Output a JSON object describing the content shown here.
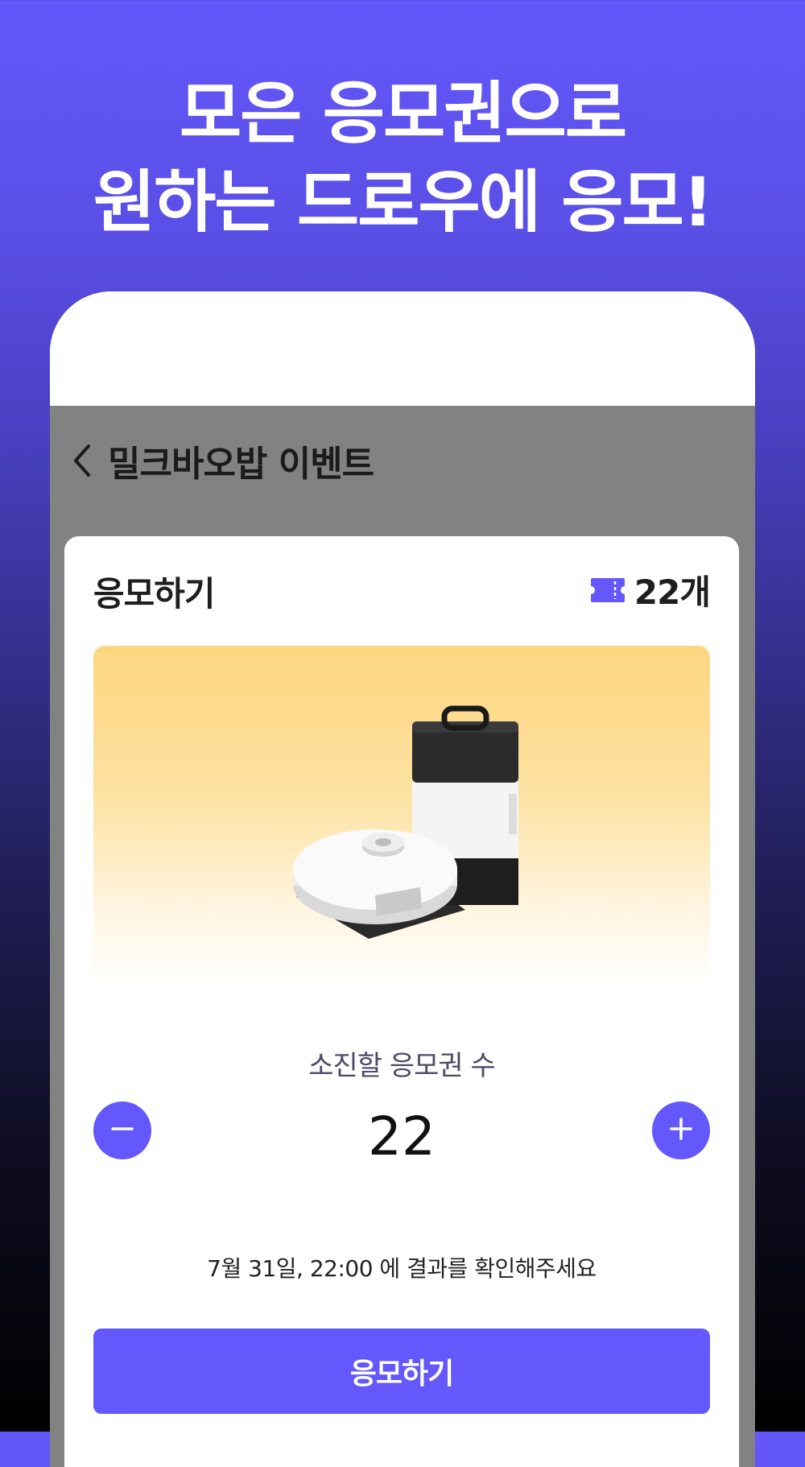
{
  "headline": {
    "line1": "모은 응모권으로",
    "line2": "원하는 드로우에 응모!"
  },
  "navbar": {
    "back_icon": "chevron-left-icon",
    "title": "밀크바오밥 이벤트"
  },
  "sheet": {
    "title": "응모하기",
    "ticket_icon": "ticket-icon",
    "ticket_count": "22개",
    "product_image": "robot-vacuum-with-dock",
    "ticket_label": "소진할 응모권 수",
    "stepper": {
      "minus_icon": "minus-icon",
      "plus_icon": "plus-icon",
      "value": "22"
    },
    "result_note": "7월 31일, 22:00 에 결과를 확인해주세요",
    "apply_button": "응모하기"
  },
  "colors": {
    "accent": "#6457fb",
    "overlay": "#828282",
    "card_gradient_top": "#fdd67f"
  }
}
